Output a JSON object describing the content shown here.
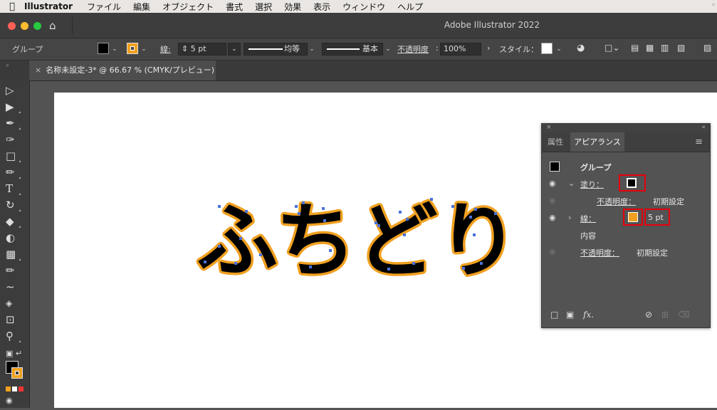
{
  "menubar": {
    "app_name": "Illustrator",
    "items": [
      "ファイル",
      "編集",
      "オブジェクト",
      "書式",
      "選択",
      "効果",
      "表示",
      "ウィンドウ",
      "ヘルプ"
    ]
  },
  "titlebar": {
    "title": "Adobe Illustrator 2022"
  },
  "controlbar": {
    "selection_type": "グループ",
    "stroke_label": "線",
    "stroke_weight": "5 pt",
    "profile_label": "均等",
    "brush_label": "基本",
    "opacity_label": "不透明度",
    "opacity_value": "100%",
    "style_label": "スタイル"
  },
  "document_tab": {
    "close": "×",
    "title": "名称未設定-3* @ 66.67 % (CMYK/プレビュー)"
  },
  "artboard": {
    "text": "ふちどり"
  },
  "appearance_panel": {
    "tabs": [
      "属性",
      "アピアランス"
    ],
    "group_label": "グループ",
    "fill_label": "塗り：",
    "opacity_label": "不透明度：",
    "opacity_value": "初期設定",
    "stroke_label": "線：",
    "stroke_weight": "5 pt",
    "content_label": "内容",
    "opacity2_label": "不透明度：",
    "opacity2_value": "初期設定"
  },
  "colors": {
    "fill": "#000000",
    "stroke": "#f0a020",
    "anchor": "#4a72d9",
    "highlight": "#e6000b"
  },
  "icons": {
    "apple": "apple-icon",
    "home": "home-icon",
    "globe": "globe-icon",
    "eye": "eye-icon",
    "fx": "fx-icon"
  }
}
